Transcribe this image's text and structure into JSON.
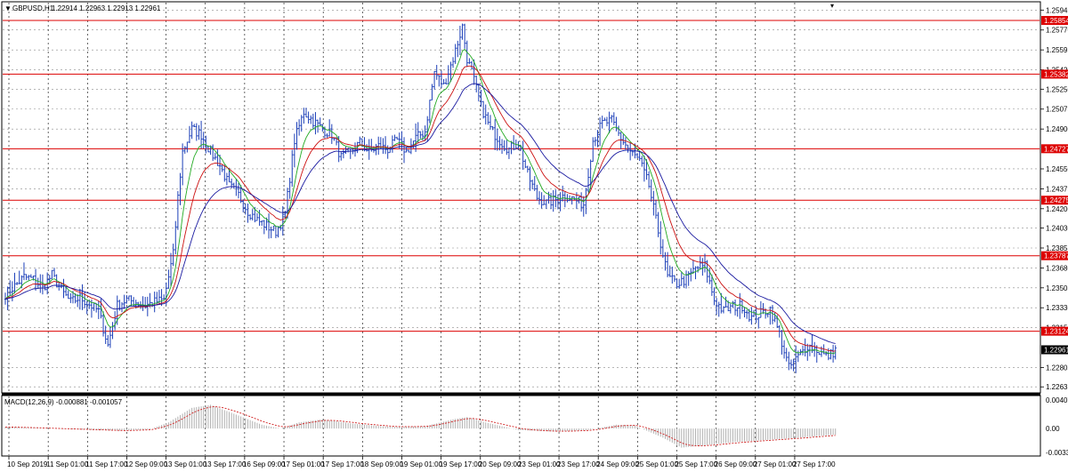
{
  "header": {
    "symbol": "GBPUSD,H1",
    "ohlc": "1.22914 1.22963 1.22913 1.22961"
  },
  "macd": {
    "label": "MACD(12,26,9) -0.000881 -0.001057",
    "axis": [
      "0.004077",
      "0.00",
      "-0.00336"
    ],
    "colors": {
      "histogram": "#b0b0b0",
      "signal": "#d02020"
    }
  },
  "price_axis_labels": [
    "1.25945",
    "1.25770",
    "1.25595",
    "1.25420",
    "1.25250",
    "1.25075",
    "1.24900",
    "1.24550",
    "1.24375",
    "1.24200",
    "1.24030",
    "1.23855",
    "1.23680",
    "1.23505",
    "1.23330",
    "1.23155",
    "1.22805",
    "1.22635"
  ],
  "time_labels": [
    "10 Sep 2019",
    "11 Sep 01:00",
    "11 Sep 17:00",
    "12 Sep 09:00",
    "13 Sep 01:00",
    "13 Sep 17:00",
    "16 Sep 09:00",
    "17 Sep 01:00",
    "17 Sep 17:00",
    "18 Sep 09:00",
    "19 Sep 01:00",
    "19 Sep 17:00",
    "20 Sep 09:00",
    "23 Sep 01:00",
    "23 Sep 17:00",
    "24 Sep 09:00",
    "25 Sep 01:00",
    "25 Sep 17:00",
    "26 Sep 09:00",
    "27 Sep 01:00",
    "27 Sep 17:00"
  ],
  "levels": [
    {
      "label": "1.25854"
    },
    {
      "label": "1.25382"
    },
    {
      "label": "1.24727"
    },
    {
      "label": "1.24275"
    },
    {
      "label": "1.23787"
    },
    {
      "label": "1.23124"
    }
  ],
  "current_price": "1.22961",
  "colors": {
    "candles": "#1c3fb8",
    "levels": "#dd0000",
    "ma_fast": "#22aa22",
    "ma_mid": "#cc1111",
    "ma_slow": "#1a1aa0",
    "grid": "#8a8a8a",
    "current_price_tag": "#000000"
  },
  "chart_data": {
    "type": "line",
    "title": "GBPUSD,H1",
    "ylim": [
      1.2259,
      1.2601
    ],
    "level_values": [
      1.25854,
      1.25382,
      1.24727,
      1.24275,
      1.23787,
      1.23124
    ],
    "anchors": [
      [
        0,
        1.2345
      ],
      [
        4,
        1.2352
      ],
      [
        8,
        1.236
      ],
      [
        12,
        1.2358
      ],
      [
        16,
        1.235
      ],
      [
        20,
        1.2362
      ],
      [
        24,
        1.2348
      ],
      [
        28,
        1.2338
      ],
      [
        32,
        1.2342
      ],
      [
        36,
        1.2336
      ],
      [
        40,
        1.233
      ],
      [
        44,
        1.23
      ],
      [
        48,
        1.2335
      ],
      [
        52,
        1.234
      ],
      [
        56,
        1.2338
      ],
      [
        60,
        1.2335
      ],
      [
        64,
        1.2338
      ],
      [
        68,
        1.234
      ],
      [
        72,
        1.238
      ],
      [
        74,
        1.243
      ],
      [
        76,
        1.247
      ],
      [
        80,
        1.249
      ],
      [
        84,
        1.2485
      ],
      [
        88,
        1.247
      ],
      [
        92,
        1.2458
      ],
      [
        96,
        1.244
      ],
      [
        100,
        1.2432
      ],
      [
        104,
        1.2418
      ],
      [
        108,
        1.241
      ],
      [
        112,
        1.2405
      ],
      [
        116,
        1.24
      ],
      [
        120,
        1.2415
      ],
      [
        124,
        1.248
      ],
      [
        128,
        1.2505
      ],
      [
        132,
        1.2497
      ],
      [
        136,
        1.249
      ],
      [
        140,
        1.2485
      ],
      [
        144,
        1.2465
      ],
      [
        148,
        1.247
      ],
      [
        152,
        1.2478
      ],
      [
        156,
        1.247
      ],
      [
        160,
        1.2475
      ],
      [
        164,
        1.2472
      ],
      [
        168,
        1.248
      ],
      [
        172,
        1.247
      ],
      [
        176,
        1.2482
      ],
      [
        180,
        1.2488
      ],
      [
        184,
        1.254
      ],
      [
        188,
        1.2528
      ],
      [
        192,
        1.2552
      ],
      [
        196,
        1.258
      ],
      [
        198,
        1.2552
      ],
      [
        200,
        1.254
      ],
      [
        204,
        1.251
      ],
      [
        208,
        1.249
      ],
      [
        212,
        1.248
      ],
      [
        216,
        1.2472
      ],
      [
        220,
        1.2478
      ],
      [
        224,
        1.245
      ],
      [
        228,
        1.243
      ],
      [
        232,
        1.2425
      ],
      [
        236,
        1.2428
      ],
      [
        240,
        1.2432
      ],
      [
        244,
        1.2428
      ],
      [
        248,
        1.2424
      ],
      [
        252,
        1.248
      ],
      [
        256,
        1.2495
      ],
      [
        260,
        1.2497
      ],
      [
        264,
        1.2482
      ],
      [
        268,
        1.247
      ],
      [
        272,
        1.2462
      ],
      [
        276,
        1.244
      ],
      [
        280,
        1.24
      ],
      [
        284,
        1.236
      ],
      [
        288,
        1.2354
      ],
      [
        292,
        1.2358
      ],
      [
        296,
        1.2368
      ],
      [
        300,
        1.237
      ],
      [
        304,
        1.234
      ],
      [
        308,
        1.233
      ],
      [
        312,
        1.2334
      ],
      [
        316,
        1.2335
      ],
      [
        320,
        1.2324
      ],
      [
        324,
        1.2328
      ],
      [
        328,
        1.2332
      ],
      [
        332,
        1.231
      ],
      [
        336,
        1.228
      ],
      [
        340,
        1.229
      ],
      [
        344,
        1.23
      ],
      [
        348,
        1.2296
      ],
      [
        352,
        1.229
      ],
      [
        354,
        1.2292
      ],
      [
        356,
        1.2296
      ]
    ],
    "macd_anchors": [
      [
        0,
        0.0002
      ],
      [
        30,
        -0.0001
      ],
      [
        50,
        -0.0003
      ],
      [
        62,
        -0.0001
      ],
      [
        70,
        0.0008
      ],
      [
        80,
        0.0027
      ],
      [
        88,
        0.0031
      ],
      [
        100,
        0.0017
      ],
      [
        110,
        0.0005
      ],
      [
        118,
        0.0
      ],
      [
        126,
        0.0008
      ],
      [
        136,
        0.0012
      ],
      [
        150,
        0.0006
      ],
      [
        166,
        0.0002
      ],
      [
        180,
        0.0003
      ],
      [
        192,
        0.0012
      ],
      [
        198,
        0.0015
      ],
      [
        206,
        0.0008
      ],
      [
        220,
        -0.0002
      ],
      [
        236,
        -0.0004
      ],
      [
        250,
        -0.0002
      ],
      [
        262,
        0.0005
      ],
      [
        270,
        0.0004
      ],
      [
        282,
        -0.0012
      ],
      [
        290,
        -0.0025
      ],
      [
        300,
        -0.0022
      ],
      [
        312,
        -0.0018
      ],
      [
        326,
        -0.0015
      ],
      [
        340,
        -0.0012
      ],
      [
        356,
        -0.0008
      ]
    ]
  }
}
